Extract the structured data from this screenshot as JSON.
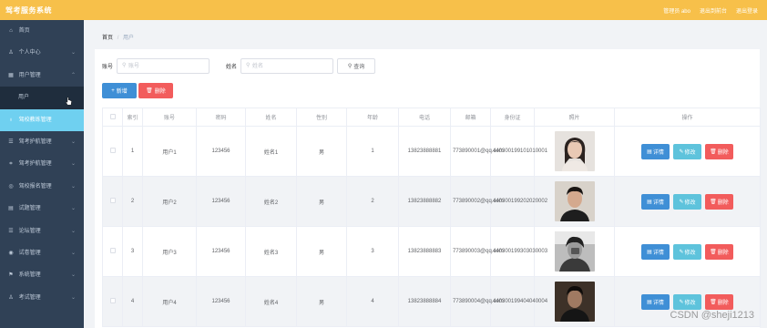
{
  "header": {
    "title": "驾考服务系统",
    "admin_label": "管理员 abo",
    "back_label": "退出到前台",
    "logout_label": "退出登录"
  },
  "sidebar": {
    "items": [
      {
        "label": "首页",
        "icon": "home-icon",
        "glyph": "⌂",
        "chevron": false
      },
      {
        "label": "个人中心",
        "icon": "user-icon",
        "glyph": "♙",
        "chevron": true
      },
      {
        "label": "用户管理",
        "icon": "grid-icon",
        "glyph": "▦",
        "chevron": true
      },
      {
        "label": "驾校教练管理",
        "icon": "bulb-icon",
        "glyph": "♁",
        "chevron": true
      },
      {
        "label": "驾考护航管理",
        "icon": "crop-icon",
        "glyph": "⌗",
        "chevron": true
      },
      {
        "label": "驾校报名管理",
        "icon": "circle-icon",
        "glyph": "◎",
        "chevron": true
      },
      {
        "label": "试题管理",
        "icon": "list-icon",
        "glyph": "▤",
        "chevron": true
      },
      {
        "label": "论坛管理",
        "icon": "menu-icon",
        "glyph": "☰",
        "chevron": true
      },
      {
        "label": "试卷管理",
        "icon": "compass-icon",
        "glyph": "◉",
        "chevron": true
      },
      {
        "label": "系统管理",
        "icon": "flag-icon",
        "glyph": "⚑",
        "chevron": true
      },
      {
        "label": "考试管理",
        "icon": "person-icon",
        "glyph": "♙",
        "chevron": true
      }
    ],
    "subitem": "用户",
    "active": "驾校教练管理"
  },
  "breadcrumb": {
    "home": "首页",
    "separator": "/",
    "current": "用户"
  },
  "search": {
    "account_label": "账号",
    "account_placeholder": "账号",
    "name_label": "姓名",
    "name_placeholder": "姓名",
    "query_label": "查询"
  },
  "actions": {
    "add_label": "新增",
    "delete_label": "删除"
  },
  "table": {
    "columns": [
      "索引",
      "账号",
      "密码",
      "姓名",
      "性别",
      "年龄",
      "电话",
      "邮箱",
      "身份证",
      "照片",
      "操作"
    ],
    "rows": [
      {
        "index": "1",
        "account": "用户1",
        "password": "123456",
        "name": "姓名1",
        "gender": "男",
        "age": "1",
        "phone": "13823888881",
        "email": "773890001@qq.com",
        "id_card": "440300199101010001"
      },
      {
        "index": "2",
        "account": "用户2",
        "password": "123456",
        "name": "姓名2",
        "gender": "男",
        "age": "2",
        "phone": "13823888882",
        "email": "773890002@qq.com",
        "id_card": "440300199202020002"
      },
      {
        "index": "3",
        "account": "用户3",
        "password": "123456",
        "name": "姓名3",
        "gender": "男",
        "age": "3",
        "phone": "13823888883",
        "email": "773890003@qq.com",
        "id_card": "440300199303030003"
      },
      {
        "index": "4",
        "account": "用户4",
        "password": "123456",
        "name": "姓名4",
        "gender": "男",
        "age": "4",
        "phone": "13823888884",
        "email": "773890004@qq.com",
        "id_card": "440300199404040004"
      }
    ],
    "row_actions": {
      "detail": "详情",
      "edit": "修改",
      "delete": "删除"
    }
  },
  "watermark": "CSDN @sheji1213",
  "colors": {
    "topbar": "#f7c04a",
    "sidebar": "#304156",
    "active_item": "#6fd0f0",
    "primary": "#3f8fd6",
    "info": "#5ec3dc",
    "danger": "#f25c5c"
  }
}
